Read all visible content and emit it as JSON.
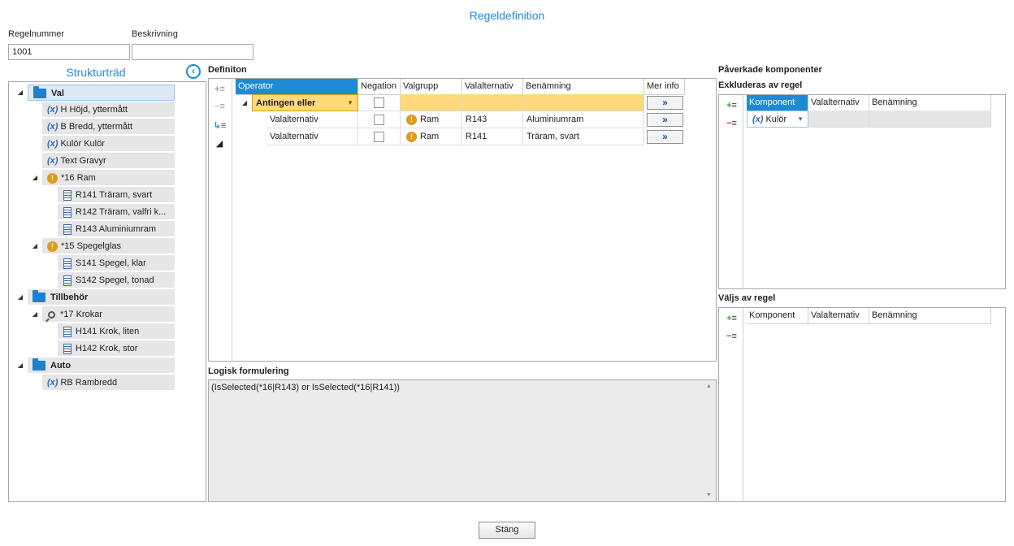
{
  "page_title": "Regeldefinition",
  "rule_number": {
    "label": "Regelnummer",
    "value": "1001"
  },
  "description": {
    "label": "Beskrivning",
    "value": ""
  },
  "tree": {
    "title": "Strukturträd",
    "items": [
      {
        "label": "Val",
        "type": "folder"
      },
      {
        "label": "H Höjd, yttermått",
        "type": "var"
      },
      {
        "label": "B Bredd, yttermått",
        "type": "var"
      },
      {
        "label": "Kulör Kulör",
        "type": "var"
      },
      {
        "label": "Text Gravyr",
        "type": "var"
      },
      {
        "label": "*16 Ram",
        "type": "group-warn"
      },
      {
        "label": "R141 Träram, svart",
        "type": "doc"
      },
      {
        "label": "R142 Träram, valfri k...",
        "type": "doc"
      },
      {
        "label": "R143 Aluminiumram",
        "type": "doc"
      },
      {
        "label": "*15 Spegelglas",
        "type": "group-warn"
      },
      {
        "label": "S141 Spegel, klar",
        "type": "doc"
      },
      {
        "label": "S142 Spegel, tonad",
        "type": "doc"
      },
      {
        "label": "Tillbehör",
        "type": "folder"
      },
      {
        "label": "*17 Krokar",
        "type": "group-search"
      },
      {
        "label": "H141 Krok, liten",
        "type": "doc"
      },
      {
        "label": "H142 Krok, stor",
        "type": "doc"
      },
      {
        "label": "Auto",
        "type": "folder"
      },
      {
        "label": "RB Rambredd",
        "type": "var"
      }
    ],
    "var_symbol": "(x)"
  },
  "definition": {
    "title": "Definiton",
    "columns": [
      "Operator",
      "Negation",
      "Valgrupp",
      "Valalternativ",
      "Benämning",
      "Mer info"
    ],
    "rows": [
      {
        "operator": "Antingen eller",
        "valgrupp": "",
        "valalternativ": "",
        "benamning": ""
      },
      {
        "operator": "Valalternativ",
        "valgrupp": "Ram",
        "valalternativ": "R143",
        "benamning": "Aluminiumram"
      },
      {
        "operator": "Valalternativ",
        "valgrupp": "Ram",
        "valalternativ": "R141",
        "benamning": "Träram, svart"
      }
    ],
    "more_symbol": "»"
  },
  "logic": {
    "title": "Logisk formulering",
    "text": "(IsSelected(*16|R143) or IsSelected(*16|R141))"
  },
  "affected": {
    "title": "Påverkade komponenter",
    "excluded": {
      "title": "Exkluderas av regel",
      "columns": [
        "Komponent",
        "Valalternativ",
        "Benämning"
      ],
      "row": {
        "komponent": "Kulör",
        "symbol": "(x)"
      }
    },
    "selected": {
      "title": "Väljs av regel",
      "columns": [
        "Komponent",
        "Valalternativ",
        "Benämning"
      ]
    }
  },
  "close_button": "Stäng",
  "colors": {
    "accent": "#1e8ad6",
    "highlight": "#ffd97a"
  }
}
